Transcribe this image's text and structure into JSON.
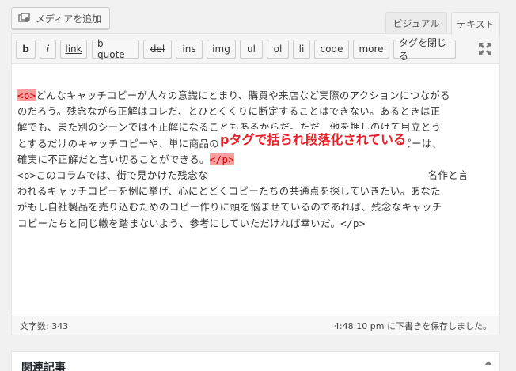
{
  "media": {
    "add_label": "メディアを追加"
  },
  "tabs": {
    "visual": "ビジュアル",
    "text": "テキスト"
  },
  "toolbar": {
    "buttons": [
      "b",
      "i",
      "link",
      "b-quote",
      "del",
      "ins",
      "img",
      "ul",
      "ol",
      "li",
      "code",
      "more",
      "タグを閉じる"
    ]
  },
  "content": {
    "lines": [
      {
        "pre": "",
        "tag": "<p>",
        "text": "どんなキャッチコピーが人々の意識にとまり、購買や来店など実際のアクションにつながる"
      },
      {
        "pre": "",
        "tag": "",
        "text": "のだろう。残念ながら正解はコレだ、とひとくくりに断定することはできない。あるときは正"
      },
      {
        "pre": "",
        "tag": "",
        "text": "解でも、また別のシーンでは不正解になることもあるからだ。ただ、他を押しのけて目立とう"
      },
      {
        "pre": "",
        "tag": "",
        "text": "とするだけのキャッチコピーや、単に商品のメリットを並べ立てるだけのキャッチコピーは、"
      },
      {
        "pre": "確実に不正解だと言い切ることができる。",
        "tag": "</p>",
        "text": ""
      },
      {
        "pre": "",
        "tag": "",
        "text": "<p>このコラムでは、街で見かけた残念な"
      },
      {
        "pre": "",
        "tag": "",
        "text": "われるキャッチコピーを例に挙げ、心にとどくコピーたちの共通点を探していきたい。あなた"
      },
      {
        "pre": "",
        "tag": "",
        "text": "がもし自社製品を売り込むためのコピー作りに頭を悩ませているのであれば、残念なキャッチ"
      },
      {
        "pre": "",
        "tag": "",
        "text": "コピーたちと同じ轍を踏まないよう、参考にしていただければ幸いだ。</p>"
      }
    ],
    "line6_suffix": "名作と言"
  },
  "annotation": {
    "text": "pタグで括られ段落化されている"
  },
  "status": {
    "word_count": "文字数: 343",
    "saved": "4:48:10 pm に下書きを保存しました。"
  },
  "related": {
    "title": "関連記事"
  }
}
